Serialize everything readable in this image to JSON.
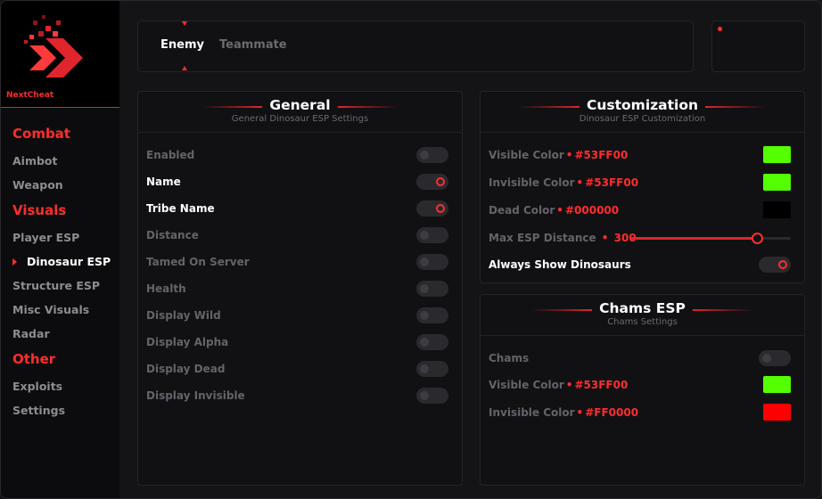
{
  "brand": {
    "name": "NextCheat"
  },
  "colors": {
    "accent": "#ff2d2d",
    "bg": "#141417",
    "panel": "#111114"
  },
  "nav": [
    {
      "category": "Combat",
      "items": [
        "Aimbot",
        "Weapon"
      ]
    },
    {
      "category": "Visuals",
      "items": [
        "Player ESP",
        "Dinosaur ESP",
        "Structure ESP",
        "Misc Visuals",
        "Radar"
      ]
    },
    {
      "category": "Other",
      "items": [
        "Exploits",
        "Settings"
      ]
    }
  ],
  "active_nav": "Dinosaur ESP",
  "tabs": {
    "enemy": "Enemy",
    "teammate": "Teammate",
    "active": "Enemy"
  },
  "general": {
    "title": "General",
    "subtitle": "General Dinosaur ESP Settings",
    "rows": [
      {
        "label": "Enabled",
        "on": false
      },
      {
        "label": "Name",
        "on": true
      },
      {
        "label": "Tribe Name",
        "on": true
      },
      {
        "label": "Distance",
        "on": false
      },
      {
        "label": "Tamed On Server",
        "on": false
      },
      {
        "label": "Health",
        "on": false
      },
      {
        "label": "Display Wild",
        "on": false
      },
      {
        "label": "Display Alpha",
        "on": false
      },
      {
        "label": "Display Dead",
        "on": false
      },
      {
        "label": "Display Invisible",
        "on": false
      }
    ]
  },
  "customization": {
    "title": "Customization",
    "subtitle": "Dinosaur ESP Customization",
    "visible_color": {
      "label": "Visible Color",
      "hex": "#53FF00"
    },
    "invisible_color": {
      "label": "Invisible Color",
      "hex": "#53FF00"
    },
    "dead_color": {
      "label": "Dead Color",
      "hex": "#000000"
    },
    "max_distance": {
      "label": "Max ESP Distance",
      "value": "300",
      "fraction": 0.79
    },
    "always_show": {
      "label": "Always Show Dinosaurs",
      "on": true
    }
  },
  "chams": {
    "title": "Chams ESP",
    "subtitle": "Chams Settings",
    "chams": {
      "label": "Chams",
      "on": false
    },
    "visible_color": {
      "label": "Visible Color",
      "hex": "#53FF00"
    },
    "invisible_color": {
      "label": "Invisible Color",
      "hex": "#FF0000"
    }
  }
}
